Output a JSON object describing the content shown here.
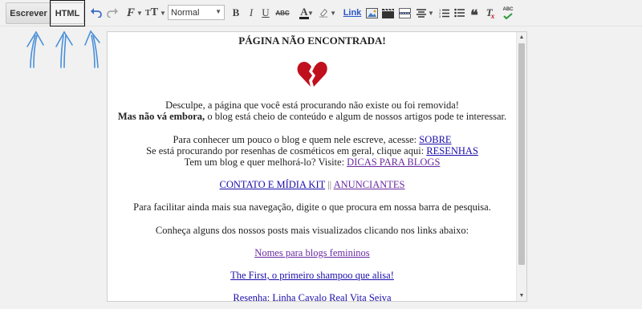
{
  "toolbar": {
    "compose_label": "Escrever",
    "html_label": "HTML",
    "format_value": "Normal",
    "link_label": "Link"
  },
  "content": {
    "title": "PÁGINA NÃO ENCONTRADA!",
    "line1": "Desculpe, a página que você está procurando não existe ou foi removida!",
    "line2_bold": "Mas não vá embora,",
    "line2_rest": " o blog está cheio de conteúdo e algum de nossos artigos pode te interessar.",
    "line3_text": "Para conhecer um pouco o blog e quem nele escreve, acesse: ",
    "line3_link": "SOBRE",
    "line4_text": "Se está procurando por resenhas de cosméticos em geral, clique aqui: ",
    "line4_link": "RESENHAS",
    "line5_text": "Tem um blog e quer melhorá-lo? Visite: ",
    "line5_link": "DICAS PARA BLOGS",
    "contact_link": "CONTATO E MÍDIA KIT",
    "separator": " || ",
    "advertisers_link": "ANUNCIANTES",
    "search_hint": "Para facilitar ainda mais sua navegação, digite o que procura em nossa barra de pesquisa.",
    "popular_hint": "Conheça alguns dos nossos posts mais visualizados clicando nos links abaixo:",
    "post1": "Nomes para blogs femininos",
    "post2": "The First, o primeiro shampoo que alisa!",
    "post3": "Resenha: Linha Cavalo Real Vita Seiva"
  },
  "colors": {
    "link": "#1a0dab",
    "visited_link": "#6a2aa0",
    "heart": "#c0101e",
    "arrows": "#4a90d9"
  }
}
